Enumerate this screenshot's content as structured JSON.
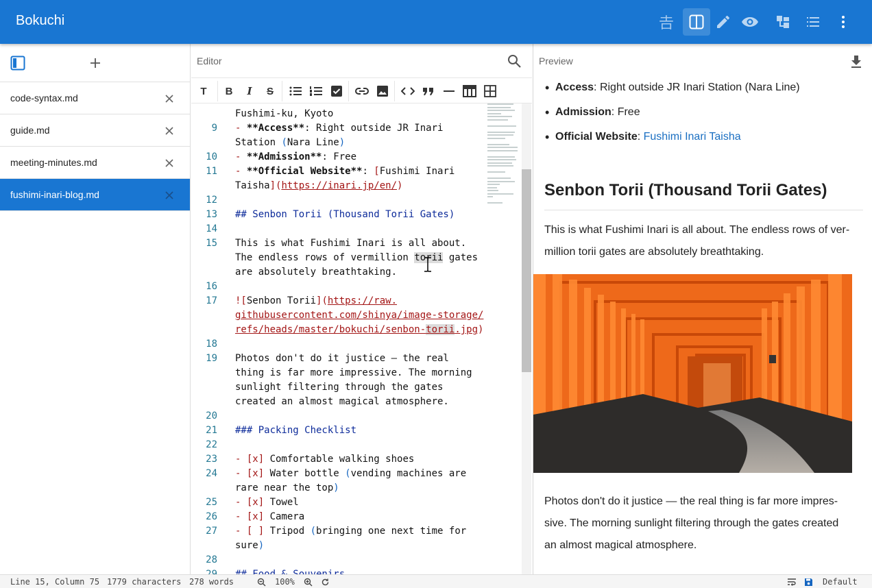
{
  "app": {
    "title": "Bokuchi"
  },
  "appbar": {
    "kanji_icon": "𠮷",
    "icons": [
      "kanji-icon",
      "split-view-icon",
      "edit-icon",
      "preview-icon",
      "outline-icon",
      "list-icon",
      "more-icon"
    ]
  },
  "sidebar": {
    "files": [
      {
        "name": "code-syntax.md",
        "active": false
      },
      {
        "name": "guide.md",
        "active": false
      },
      {
        "name": "meeting-minutes.md",
        "active": false
      },
      {
        "name": "fushimi-inari-blog.md",
        "active": true
      }
    ]
  },
  "editor": {
    "label": "Editor",
    "lines": [
      {
        "n": "",
        "parts": [
          [
            "",
            "Fushimi-ku, Kyoto"
          ]
        ]
      },
      {
        "n": "9",
        "parts": [
          [
            "mk",
            "- "
          ],
          [
            "b",
            "**Access**"
          ],
          [
            "",
            ": Right outside JR Inari"
          ]
        ]
      },
      {
        "n": "",
        "parts": [
          [
            "",
            "Station "
          ],
          [
            "br",
            "("
          ],
          [
            "",
            "Nara Line"
          ],
          [
            "br",
            ")"
          ]
        ]
      },
      {
        "n": "10",
        "parts": [
          [
            "mk",
            "- "
          ],
          [
            "b",
            "**Admission**"
          ],
          [
            "",
            ": Free"
          ]
        ]
      },
      {
        "n": "11",
        "parts": [
          [
            "mk",
            "- "
          ],
          [
            "b",
            "**Official Website**"
          ],
          [
            "",
            ": "
          ],
          [
            "mk",
            "["
          ],
          [
            "",
            "Fushimi Inari"
          ]
        ]
      },
      {
        "n": "",
        "parts": [
          [
            "",
            "Taisha"
          ],
          [
            "mk",
            "]("
          ],
          [
            "lnk",
            "https://inari.jp/en/"
          ],
          [
            "mk",
            ")"
          ]
        ]
      },
      {
        "n": "12",
        "parts": []
      },
      {
        "n": "13",
        "parts": [
          [
            "h",
            "## Senbon Torii (Thousand Torii Gates)"
          ]
        ]
      },
      {
        "n": "14",
        "parts": []
      },
      {
        "n": "15",
        "parts": [
          [
            "",
            "This is what Fushimi Inari is all about."
          ]
        ]
      },
      {
        "n": "",
        "parts": [
          [
            "",
            "The endless rows of vermillion "
          ],
          [
            "sel",
            "torii"
          ],
          [
            "",
            " gates"
          ]
        ]
      },
      {
        "n": "",
        "parts": [
          [
            "",
            "are absolutely breathtaking."
          ]
        ]
      },
      {
        "n": "16",
        "parts": []
      },
      {
        "n": "17",
        "parts": [
          [
            "mk",
            "!["
          ],
          [
            "",
            "Senbon Torii"
          ],
          [
            "mk",
            "]("
          ],
          [
            "lnk",
            "https://raw."
          ]
        ]
      },
      {
        "n": "",
        "parts": [
          [
            "lnk",
            "githubusercontent.com/shinya/image-storage/"
          ]
        ]
      },
      {
        "n": "",
        "parts": [
          [
            "lnk",
            "refs/heads/master/bokuchi/senbon-"
          ],
          [
            "lnk sel",
            "torii"
          ],
          [
            "lnk",
            ".jpg"
          ],
          [
            "mk",
            ")"
          ]
        ]
      },
      {
        "n": "18",
        "parts": []
      },
      {
        "n": "19",
        "parts": [
          [
            "",
            "Photos don't do it justice — the real"
          ]
        ]
      },
      {
        "n": "",
        "parts": [
          [
            "",
            "thing is far more impressive. The morning"
          ]
        ]
      },
      {
        "n": "",
        "parts": [
          [
            "",
            "sunlight filtering through the gates"
          ]
        ]
      },
      {
        "n": "",
        "parts": [
          [
            "",
            "created an almost magical atmosphere."
          ]
        ]
      },
      {
        "n": "20",
        "parts": []
      },
      {
        "n": "21",
        "parts": [
          [
            "h",
            "### Packing Checklist"
          ]
        ]
      },
      {
        "n": "22",
        "parts": []
      },
      {
        "n": "23",
        "parts": [
          [
            "mk",
            "- [x] "
          ],
          [
            "",
            "Comfortable walking shoes"
          ]
        ]
      },
      {
        "n": "24",
        "parts": [
          [
            "mk",
            "- [x] "
          ],
          [
            "",
            "Water bottle "
          ],
          [
            "br",
            "("
          ],
          [
            "",
            "vending machines are"
          ]
        ]
      },
      {
        "n": "",
        "parts": [
          [
            "",
            "rare near the top"
          ],
          [
            "br",
            ")"
          ]
        ]
      },
      {
        "n": "25",
        "parts": [
          [
            "mk",
            "- [x] "
          ],
          [
            "",
            "Towel"
          ]
        ]
      },
      {
        "n": "26",
        "parts": [
          [
            "mk",
            "- [x] "
          ],
          [
            "",
            "Camera"
          ]
        ]
      },
      {
        "n": "27",
        "parts": [
          [
            "mk",
            "- [ ] "
          ],
          [
            "",
            "Tripod "
          ],
          [
            "br",
            "("
          ],
          [
            "",
            "bringing one next time for"
          ]
        ]
      },
      {
        "n": "",
        "parts": [
          [
            "",
            "sure"
          ],
          [
            "br",
            ")"
          ]
        ]
      },
      {
        "n": "28",
        "parts": []
      },
      {
        "n": "29",
        "parts": [
          [
            "h",
            "## Food & Souvenirs"
          ]
        ]
      }
    ]
  },
  "preview": {
    "label": "Preview",
    "list": [
      {
        "key": "Access",
        "rest": ": Right outside JR Inari Station (Nara Line)"
      },
      {
        "key": "Admission",
        "rest": ": Free"
      },
      {
        "key": "Official Website",
        "rest": ": ",
        "link": "Fushimi Inari Taisha"
      }
    ],
    "heading": "Senbon Torii (Thousand Torii Gates)",
    "para1_line1": "This is what Fushimi Inari is all about. The endless rows of ver-",
    "para1_line2": "million torii gates are absolutely breathtaking.",
    "para2_line1": "Photos don't do it justice — the real thing is far more impres-",
    "para2_line2": "sive. The morning sunlight filtering through the gates created",
    "para2_line3": "an almost magical atmosphere."
  },
  "status": {
    "position": "Line 15, Column 75",
    "characters": "1779 characters",
    "words": "278 words",
    "zoom": "100%",
    "theme": "Default"
  },
  "colors": {
    "primary": "#1976d2",
    "torii": "#e8621a"
  }
}
